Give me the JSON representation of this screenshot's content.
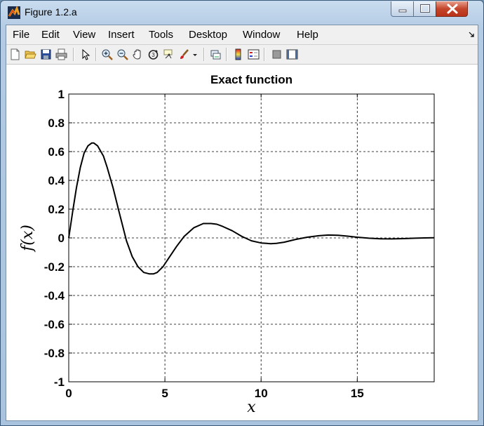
{
  "window": {
    "title": "Figure 1.2.a",
    "icon": "matlab-figure-icon",
    "controls": [
      "minimize-icon",
      "maximize-icon",
      "close-icon"
    ]
  },
  "menubar": {
    "items": [
      "File",
      "Edit",
      "View",
      "Insert",
      "Tools",
      "Desktop",
      "Window",
      "Help"
    ]
  },
  "toolbar": {
    "buttons": [
      "new-figure-icon",
      "open-file-icon",
      "save-icon",
      "print-icon",
      "edit-plot-arrow-icon",
      "zoom-in-icon",
      "zoom-out-icon",
      "pan-hand-icon",
      "rotate-3d-icon",
      "data-cursor-icon",
      "brush-icon",
      "brush-dropdown-icon",
      "link-plot-icon",
      "insert-colorbar-icon",
      "insert-legend-icon",
      "hide-plot-tools-icon",
      "show-plot-tools-icon"
    ]
  },
  "chart_data": {
    "type": "line",
    "title": "Exact function",
    "xlabel": "x",
    "ylabel": "f(x)",
    "xlim": [
      0,
      19
    ],
    "ylim": [
      -1,
      1
    ],
    "x_ticks": [
      "0",
      "5",
      "10",
      "15"
    ],
    "y_ticks": [
      "1",
      "0.8",
      "0.6",
      "0.4",
      "0.2",
      "0",
      "-0.2",
      "-0.4",
      "-0.6",
      "-0.8",
      "-1"
    ],
    "grid": true,
    "line_color": "#000000",
    "series": [
      {
        "x": [
          0,
          0.2,
          0.4,
          0.6,
          0.8,
          1.0,
          1.2,
          1.3,
          1.5,
          1.8,
          2.0,
          2.3,
          2.6,
          3.0,
          3.3,
          3.6,
          3.9,
          4.2,
          4.4,
          4.6,
          4.9,
          5.2,
          5.6,
          6.0,
          6.5,
          7.0,
          7.4,
          7.7,
          8.0,
          8.5,
          9.0,
          9.5,
          10.0,
          10.5,
          10.8,
          11.2,
          11.8,
          12.4,
          13.0,
          13.5,
          14.0,
          14.5,
          15.0,
          15.6,
          16.2,
          16.8,
          17.4,
          18.0,
          18.5,
          19.0
        ],
        "y": [
          0,
          0.18,
          0.35,
          0.49,
          0.59,
          0.64,
          0.66,
          0.66,
          0.64,
          0.57,
          0.49,
          0.35,
          0.19,
          -0.02,
          -0.13,
          -0.2,
          -0.24,
          -0.25,
          -0.25,
          -0.24,
          -0.2,
          -0.14,
          -0.06,
          0.01,
          0.07,
          0.1,
          0.1,
          0.095,
          0.08,
          0.05,
          0.01,
          -0.02,
          -0.035,
          -0.04,
          -0.038,
          -0.03,
          -0.01,
          0.005,
          0.015,
          0.02,
          0.018,
          0.012,
          0.005,
          -0.002,
          -0.006,
          -0.007,
          -0.005,
          -0.002,
          0.0,
          0.001
        ]
      }
    ]
  }
}
